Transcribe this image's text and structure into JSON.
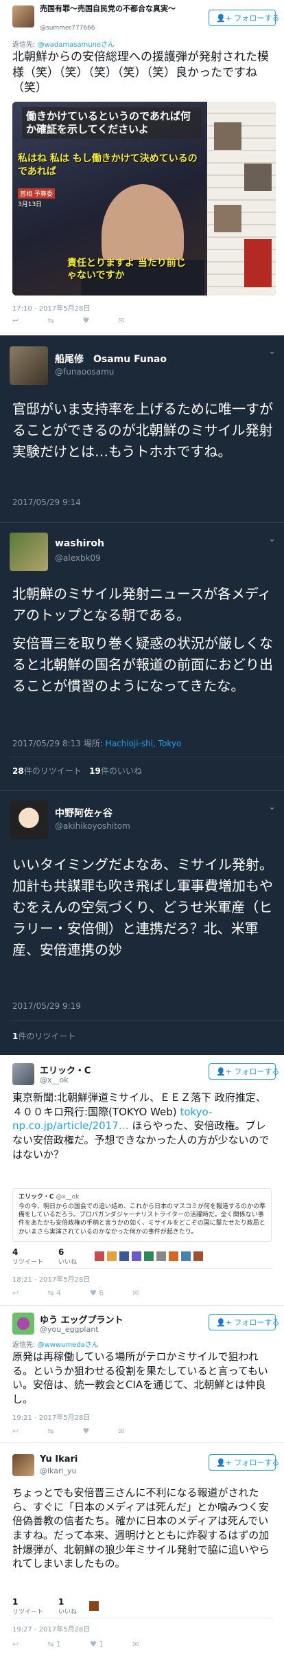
{
  "tweet1": {
    "name": "売国有罪〜売国自民党の不都合な真実〜",
    "handle": "@summer777666",
    "follow_label": "フォローする",
    "reply_prefix": "返信先:",
    "reply_to": "@wadamasamuneさん",
    "text": "北朝鮮からの安倍総理への援護弾が発射された模様（笑）（笑）（笑）（笑）（笑）良かったですね（笑）",
    "image": {
      "caption_top": "働きかけているというのであれば何か確証を示してくださいよ",
      "caption_mid": "私はね 私は もし働きかけて決めているのであれば",
      "caption_bottom": "責任とりますよ 当たり前じゃないですか",
      "side_label": "首相 予算委",
      "date_label": "3月13日"
    },
    "timestamp": "17:10 - 2017年5月28日"
  },
  "tweet2": {
    "name": "船尾修　Osamu Funao",
    "handle": "@funaoosamu",
    "text": "官邸がいま支持率を上げるために唯一すがることができるのが北朝鮮のミサイル発射実験だけとは…もうトホホですね。",
    "timestamp": "2017/05/29 9:14"
  },
  "tweet3": {
    "name": "washiroh",
    "handle": "@alexbk09",
    "para1": "北朝鮮のミサイル発射ニュースが各メディアのトップとなる朝である。",
    "para2": "安倍晋三を取り巻く疑惑の状況が厳しくなると北朝鮮の国名が報道の前面におどり出ることが慣習のようになってきたな。",
    "timestamp": "2017/05/29 8:13",
    "location_prefix": "場所:",
    "location": "Hachioji-shi, Tokyo",
    "retweets": "28",
    "retweets_label": "件のリツイート",
    "likes": "19",
    "likes_label": "件のいいね"
  },
  "tweet4": {
    "name": "中野阿佐ヶ谷",
    "handle": "@akihikoyoshitom",
    "text": "いいタイミングだよなあ、ミサイル発射。加計も共謀罪も吹き飛ばし軍事費増加もやむをえんの空気づくり、どうせ米軍産（ヒラリー・安倍側）と連携だろ？北、米軍産、安倍連携の妙",
    "timestamp": "2017/05/29 9:19",
    "retweets": "1",
    "retweets_label": "件のリツイート"
  },
  "tweet5": {
    "name": "エリック・C",
    "handle": "@x__ok",
    "follow_label": "フォローする",
    "text_main": "東京新聞:北朝鮮弾道ミサイル、ＥＥＺ落下 政府推定、４００キロ飛行:国際(TOKYO Web)",
    "link": "tokyo-np.co.jp/article/2017…",
    "text_end": "ほらやった、安倍政権。ブレない安倍政権だ。予想できなかった人の方が少ないのではないか？",
    "quote_name": "エリック・C",
    "quote_handle": "@x__ok",
    "quote_text": "今の今、明日からの国会での追い詰め、これから日本のマスコミが何を報道するのかの準備をしているだろう。プロパガンダジャーナリストライターの活躍時だ。全く関係ない事件をあたかも安倍政権の手柄と言うかの如く、ミサイルをどこぞの国に撃たせたり政局とかいまさら実演されているのかなかった何かの事件が起きたり。",
    "retweets": "4",
    "retweets_label": "リツイート",
    "likes": "6",
    "likes_label": "いいね",
    "timestamp": "18:21 - 2017年5月28日",
    "action_rt": "4",
    "action_like": "6"
  },
  "tweet6": {
    "name": "ゆう エッグプラント",
    "handle": "@you_eggplant",
    "follow_label": "フォローする",
    "reply_prefix": "返信先:",
    "reply_to": "@wwwumedaさん",
    "text": "原発は再稼働している場所がテロかミサイルで狙われる。というか狙わせる役割を果たしていると言ってもいい。安倍は、統一教会とCIAを通じて、北朝鮮とは仲良し。",
    "timestamp": "19:21 - 2017年5月28日"
  },
  "tweet7": {
    "name": "Yu Ikari",
    "handle": "@ikari_yu",
    "follow_label": "フォローする",
    "text": "ちょっとでも安倍晋三さんに不利になる報道がされたら、すぐに「日本のメディアは死んだ」とか噛みつく安倍偽善教の信者たち。確かに日本のメディアは死んでいますね。だって本来、週明けとともに炸裂するはずの加計爆弾が、北朝鮮の狼少年ミサイル発射で脇に追いやられてしまいましたもの。",
    "retweets": "1",
    "retweets_label": "リツイート",
    "likes": "1",
    "likes_label": "いいね",
    "timestamp": "19:27 - 2017年5月28日",
    "action_rt": "1",
    "action_like": "1"
  }
}
